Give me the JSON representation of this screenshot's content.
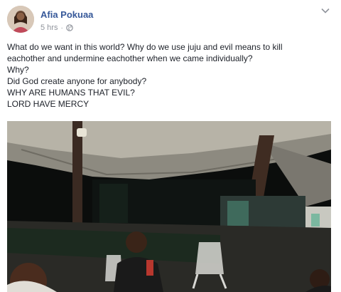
{
  "post": {
    "author": "Afia Pokuaa",
    "timestamp": "5 hrs",
    "separator": "·",
    "privacy_icon": "globe-icon",
    "options_icon": "chevron-down-icon",
    "lines": [
      "What do we want in this world? Why do we use juju and evil means to kill",
      "eachother and undermine eachother when we came individually?",
      "Why?",
      "Did God create anyone for anybody?",
      "WHY ARE HUMANS THAT EVIL?",
      "LORD HAVE MERCY"
    ]
  },
  "colors": {
    "author_link": "#365899",
    "meta_text": "#90949c",
    "body_text": "#1d2129"
  }
}
